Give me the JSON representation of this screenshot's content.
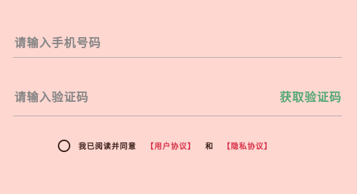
{
  "phone": {
    "placeholder": "请输入手机号码"
  },
  "code": {
    "placeholder": "请输入验证码",
    "get_code_label": "获取验证码"
  },
  "agreement": {
    "prefix": "我已阅读并同意",
    "user_agreement": "【用户协议】",
    "conjunction": "和",
    "privacy_policy": "【隐私协议】"
  },
  "colors": {
    "background": "#fed7d1",
    "accent": "#54a878",
    "link": "#d8344a"
  }
}
